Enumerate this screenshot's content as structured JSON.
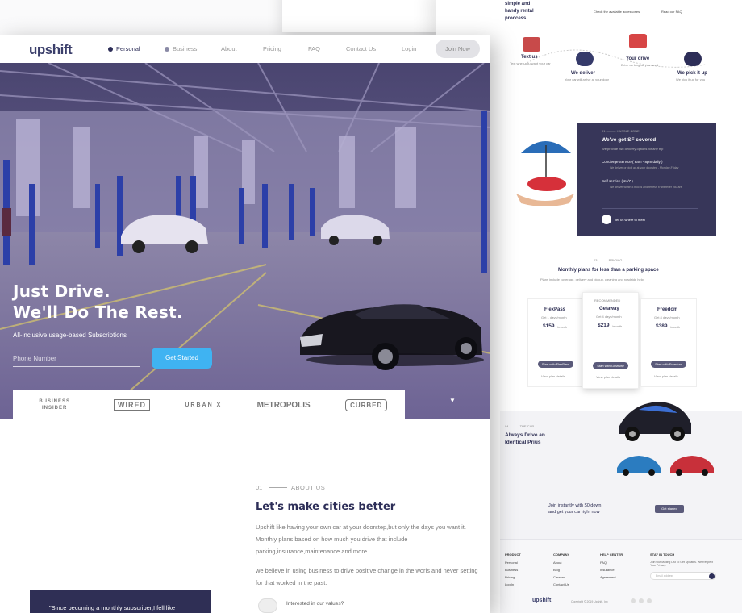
{
  "back": {
    "rental_title_1": "simple and",
    "rental_title_2": "handy rental",
    "rental_title_3": "proccess",
    "link_check": "Check the available accessories",
    "link_faq": "Read our FAQ",
    "steps": [
      {
        "title": "Text us",
        "desc": "Text when you want your car"
      },
      {
        "title": "We deliver",
        "desc": "Your car will arrive at your door"
      },
      {
        "title": "Your drive",
        "desc": "Drive as long as you need"
      },
      {
        "title": "We pick it up",
        "desc": "We pick it up for you"
      }
    ],
    "covered_kicker": "01 ——— HASSLE ZONE",
    "covered_title": "We've got SF covered",
    "covered_sub": "We provide two delivery options for any trip",
    "covered_items": [
      {
        "title": "Concierge Service ( 8am - 8pm daily )",
        "desc": "We deliver or pick up at your doorstep - Monday-Friday"
      },
      {
        "title": "Self service ( 24/7 )",
        "desc": "We deliver within 3 blocks and refresh it wherever you are"
      }
    ],
    "covered_footer": "Tell us where to meet",
    "pricing_kicker": "03 ——— PRICING",
    "pricing_title": "Monthly plans for less than a parking space",
    "pricing_sub": "Plans include coverage, delivery and pickup, cleaning and roadside help",
    "plans": [
      {
        "name": "FlexPass",
        "sub": "Get 1 days/month",
        "price": "$159",
        "unit": "/month",
        "cta": "Start with FlexPass",
        "more": "View plan details"
      },
      {
        "name": "Getaway",
        "sub": "Get 4 days/month",
        "price": "$219",
        "unit": "/month",
        "cta": "Start with Getaway",
        "more": "View plan details",
        "badge": "RECOMMENDED"
      },
      {
        "name": "Freedom",
        "sub": "Get 8 days/month",
        "price": "$389",
        "unit": "/month",
        "cta": "Start with Freedom",
        "more": "View plan details"
      }
    ],
    "car_kicker": "04 ——— THE CAR",
    "car_title_1": "Always Drive an",
    "car_title_2": "Identical Prius",
    "cta_text_1": "Join instantly with $0 down",
    "cta_text_2": "and get your car right now",
    "cta_button": "Get started",
    "footer": {
      "product": "PRODUCT",
      "company": "COMPANY",
      "help": "HELP CENTER",
      "stay": "STAY IN TOUCH",
      "product_items": [
        "Personal",
        "Business",
        "Pricing",
        "Log In"
      ],
      "company_items": [
        "About",
        "Blog",
        "Careers",
        "Contact Us"
      ],
      "help_items": [
        "FAQ",
        "Insurance",
        "Agreement"
      ],
      "stay_text": "Join Our Mailing List To Get Updates. We Respect Your Privacy.",
      "email_placeholder": "Email address",
      "logo": "upshift",
      "copyright": "Copyright © 2019 Upshift, Inc"
    }
  },
  "nav": {
    "logo": "upshift",
    "personal": "Personal",
    "business": "Business",
    "about": "About",
    "pricing": "Pricing",
    "faq": "FAQ",
    "contact": "Contact Us",
    "login": "Login",
    "join": "Join Now",
    "personal_dot": "#2d2e58",
    "business_dot": "#8a8aa6"
  },
  "hero": {
    "title_1": "Just Drive.",
    "title_2": "We'll Do The Rest.",
    "subtitle": "All-inclusive,usage-based Subscriptions",
    "phone_placeholder": "Phone Number",
    "cta": "Get Started",
    "press": [
      "BUSINESS INSIDER",
      "WIRED",
      "URBAN X",
      "METROPOLIS",
      "CURBED"
    ]
  },
  "about": {
    "num": "01",
    "label": "ABOUT US",
    "title": "Let's make cities better",
    "p1": "Upshift like having your own car at your doorstep,but only the days you want it. Monthly plans based on how much you drive that include parking,insurance,maintenance and more.",
    "p2": "we believe in using business to drive positive change in the worls and never setting for that worked in the past.",
    "quote": "\"Since becoming a monthly subscriber,I fell like",
    "interest": "Interested in our values?"
  },
  "colors": {
    "brand": "#2d2e58",
    "accent": "#3fb3f2",
    "hero_overlay": "#5b4a8a"
  }
}
